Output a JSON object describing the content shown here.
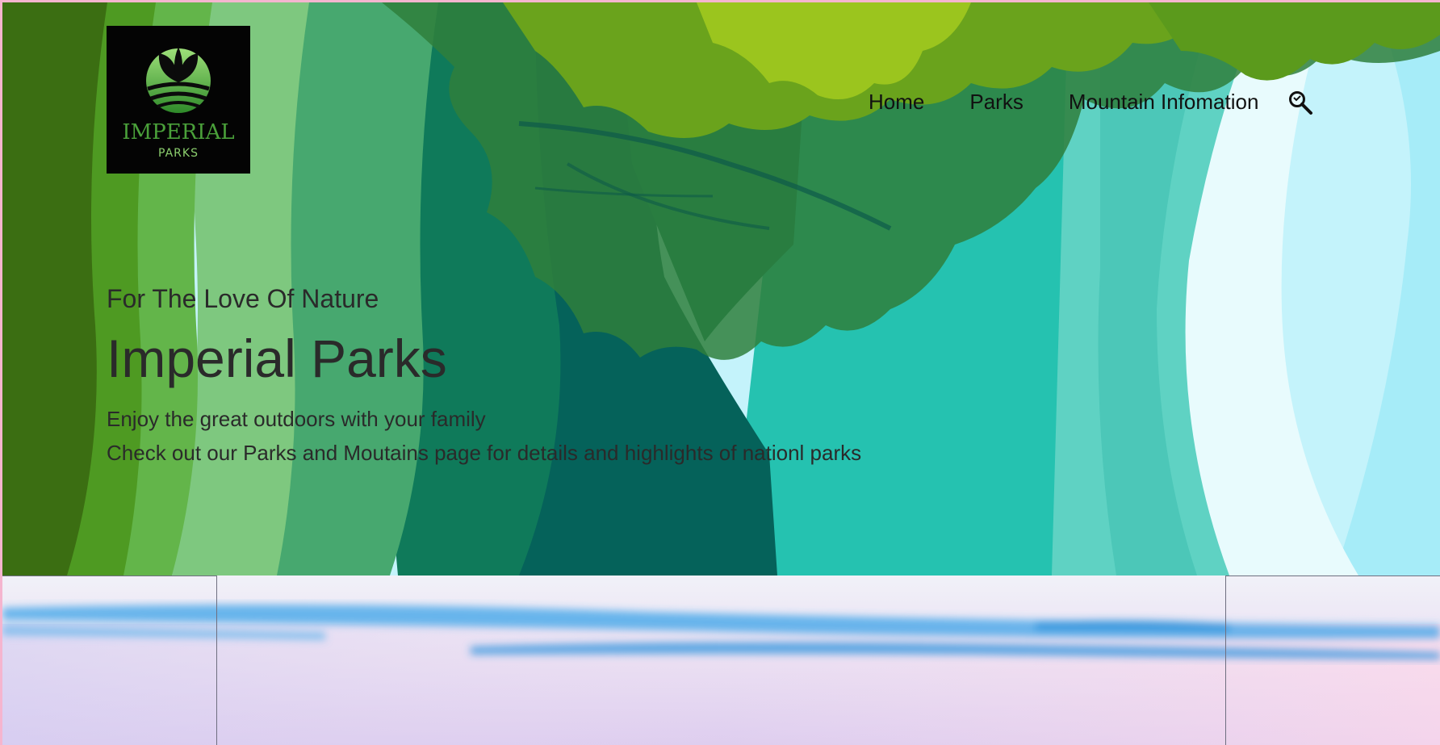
{
  "logo": {
    "brand": "IMPERIAL",
    "sub": "PARKS",
    "icon": "leaf-logo-icon"
  },
  "nav": {
    "items": [
      {
        "label": "Home"
      },
      {
        "label": "Parks"
      },
      {
        "label": "Mountain Infomation"
      }
    ],
    "search_icon": "search-icon"
  },
  "hero": {
    "tagline": "For The Love Of Nature",
    "title": "Imperial Parks",
    "line1": "Enjoy the great outdoors with your family",
    "line2": "Check out our Parks and Moutains page for details and highlights of nationl parks"
  },
  "colors": {
    "page_border": "#f5b5cf",
    "forest_dark": "#3b6e12",
    "forest_mid": "#0f7a5a",
    "teal": "#25c2b0",
    "sky": "#bff2fb",
    "logo_bg": "#040404"
  }
}
